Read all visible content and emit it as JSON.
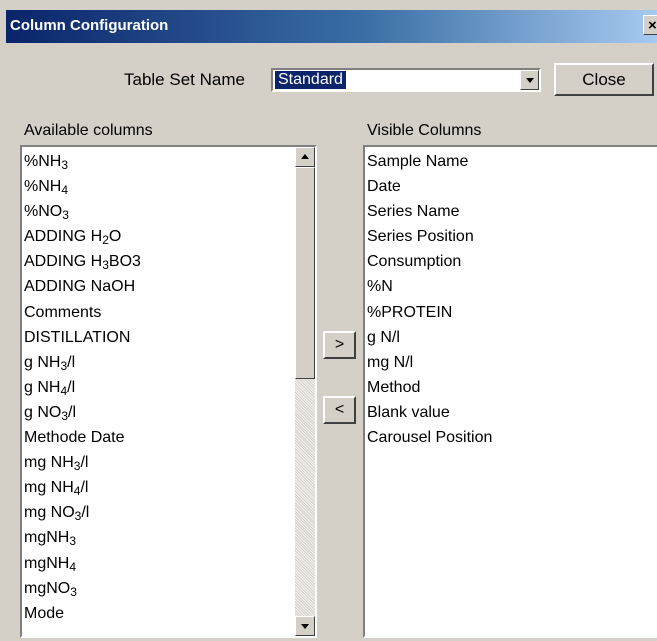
{
  "window": {
    "title": "Column Configuration",
    "close_glyph": "×"
  },
  "table_set": {
    "label": "Table Set Name",
    "selected": "Standard"
  },
  "buttons": {
    "close": "Close",
    "add": ">",
    "remove": "<"
  },
  "available": {
    "label": "Available columns",
    "items": [
      {
        "base": "%NH",
        "sub": "3",
        "tail": ""
      },
      {
        "base": "%NH",
        "sub": "4",
        "tail": ""
      },
      {
        "base": "%NO",
        "sub": "3",
        "tail": ""
      },
      {
        "base": "ADDING H",
        "sub": "2",
        "tail": "O"
      },
      {
        "base": "ADDING H",
        "sub": "3",
        "tail": "BO3"
      },
      {
        "base": "ADDING NaOH",
        "sub": "",
        "tail": ""
      },
      {
        "base": "Comments",
        "sub": "",
        "tail": ""
      },
      {
        "base": "DISTILLATION",
        "sub": "",
        "tail": ""
      },
      {
        "base": "g NH",
        "sub": "3",
        "tail": "/l"
      },
      {
        "base": "g NH",
        "sub": "4",
        "tail": "/l"
      },
      {
        "base": "g NO",
        "sub": "3",
        "tail": "/l"
      },
      {
        "base": "Methode Date",
        "sub": "",
        "tail": ""
      },
      {
        "base": "mg NH",
        "sub": "3",
        "tail": "/l"
      },
      {
        "base": "mg NH",
        "sub": "4",
        "tail": "/l"
      },
      {
        "base": "mg NO",
        "sub": "3",
        "tail": "/l"
      },
      {
        "base": "mgNH",
        "sub": "3",
        "tail": ""
      },
      {
        "base": "mgNH",
        "sub": "4",
        "tail": ""
      },
      {
        "base": "mgNO",
        "sub": "3",
        "tail": ""
      },
      {
        "base": "Mode",
        "sub": "",
        "tail": ""
      }
    ]
  },
  "visible": {
    "label": "Visible Columns",
    "items": [
      "Sample Name",
      "Date",
      "Series Name",
      "Series Position",
      "Consumption",
      "%N",
      "%PROTEIN",
      "g N/l",
      "mg N/l",
      "Method",
      "Blank value",
      "Carousel Position"
    ]
  },
  "icons": {
    "dropdown": "chevron-down-icon",
    "scroll_up": "arrow-up-icon",
    "scroll_down": "arrow-down-icon"
  }
}
